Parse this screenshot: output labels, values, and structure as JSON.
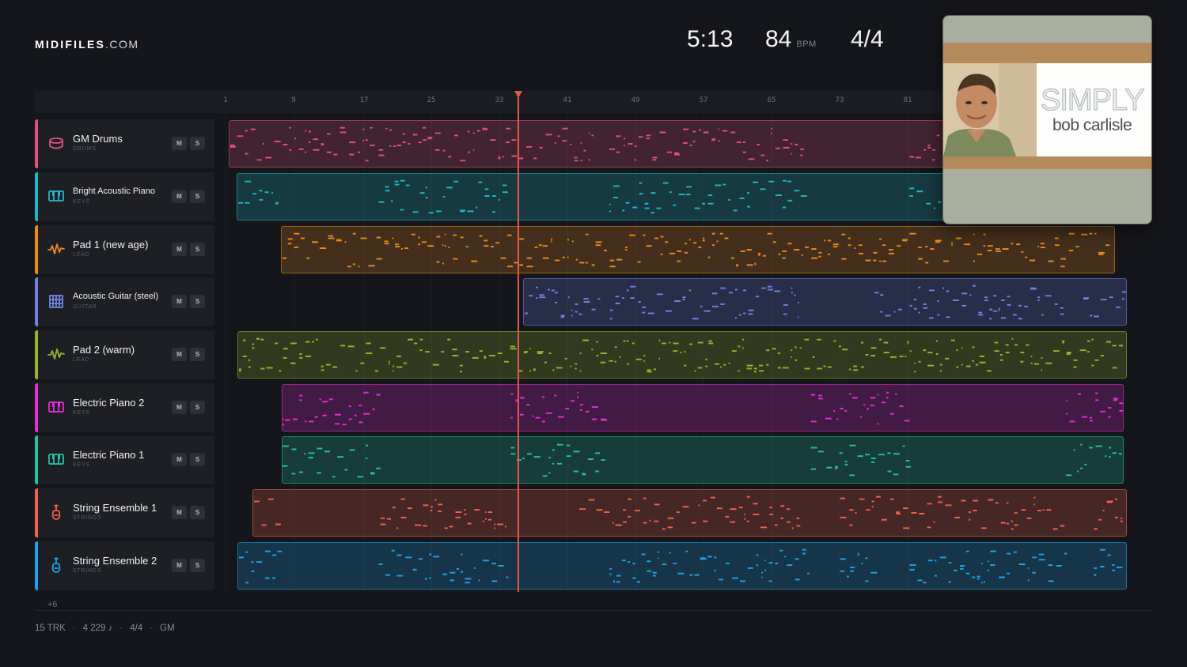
{
  "brand": {
    "name": "MIDIFILES",
    "suffix": ".COM"
  },
  "transport": {
    "time": "5:13",
    "bpm": "84",
    "bpm_unit": "BPM",
    "time_signature": "4/4"
  },
  "ruler": {
    "bars": [
      "1",
      "9",
      "17",
      "25",
      "33",
      "41",
      "49",
      "57",
      "65",
      "73",
      "81"
    ]
  },
  "album": {
    "title": "SIMPLY",
    "artist": "bob carlisle"
  },
  "tracks": [
    {
      "name": "GM Drums",
      "category": "DRUMS",
      "color": "#e0507f",
      "icon": "drum-icon",
      "mute": "M",
      "solo": "S"
    },
    {
      "name": "Bright Acoustic Piano",
      "category": "KEYS",
      "color": "#1fb7c8",
      "icon": "piano-icon",
      "mute": "M",
      "solo": "S"
    },
    {
      "name": "Pad 1 (new age)",
      "category": "LEAD",
      "color": "#e98a1c",
      "icon": "wave-icon",
      "mute": "M",
      "solo": "S"
    },
    {
      "name": "Acoustic Guitar (steel)",
      "category": "GUITAR",
      "color": "#6f82e4",
      "icon": "guitar-icon",
      "mute": "M",
      "solo": "S"
    },
    {
      "name": "Pad 2 (warm)",
      "category": "LEAD",
      "color": "#98b52a",
      "icon": "wave-icon",
      "mute": "M",
      "solo": "S"
    },
    {
      "name": "Electric Piano 2",
      "category": "KEYS",
      "color": "#e22fd6",
      "icon": "piano-icon",
      "mute": "M",
      "solo": "S"
    },
    {
      "name": "Electric Piano 1",
      "category": "KEYS",
      "color": "#22c2a3",
      "icon": "piano-icon",
      "mute": "M",
      "solo": "S"
    },
    {
      "name": "String Ensemble 1",
      "category": "STRINGS",
      "color": "#f0634a",
      "icon": "violin-icon",
      "mute": "M",
      "solo": "S"
    },
    {
      "name": "String Ensemble 2",
      "category": "STRINGS",
      "color": "#1fa3e6",
      "icon": "violin-icon",
      "mute": "M",
      "solo": "S"
    }
  ],
  "more_tracks": "+6",
  "footer": {
    "tracks": "15 TRK",
    "notes": "4 229 ♪",
    "signature": "4/4",
    "standard": "GM"
  }
}
